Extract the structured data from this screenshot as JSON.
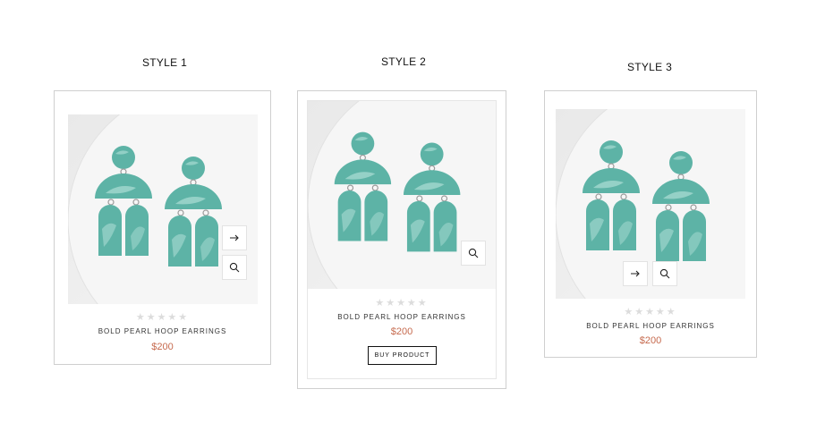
{
  "styles": [
    {
      "title": "STYLE 1",
      "product_name": "BOLD PEARL HOOP EARRINGS",
      "price": "$200",
      "stars": "★★★★★",
      "icons": [
        "arrow-right-icon",
        "zoom-icon"
      ]
    },
    {
      "title": "STYLE 2",
      "product_name": "BOLD PEARL HOOP EARRINGS",
      "price": "$200",
      "stars": "★★★★★",
      "buy_label": "BUY PRODUCT",
      "icons": [
        "zoom-icon"
      ]
    },
    {
      "title": "STYLE 3",
      "product_name": "BOLD PEARL HOOP EARRINGS",
      "price": "$200",
      "stars": "★★★★★",
      "icons": [
        "arrow-right-icon",
        "zoom-icon"
      ]
    }
  ],
  "colors": {
    "accent_price": "#c66a4e",
    "earring_teal": "#5db3a6",
    "star_empty": "#dcdcdc",
    "card_border": "#cfcfcf"
  }
}
